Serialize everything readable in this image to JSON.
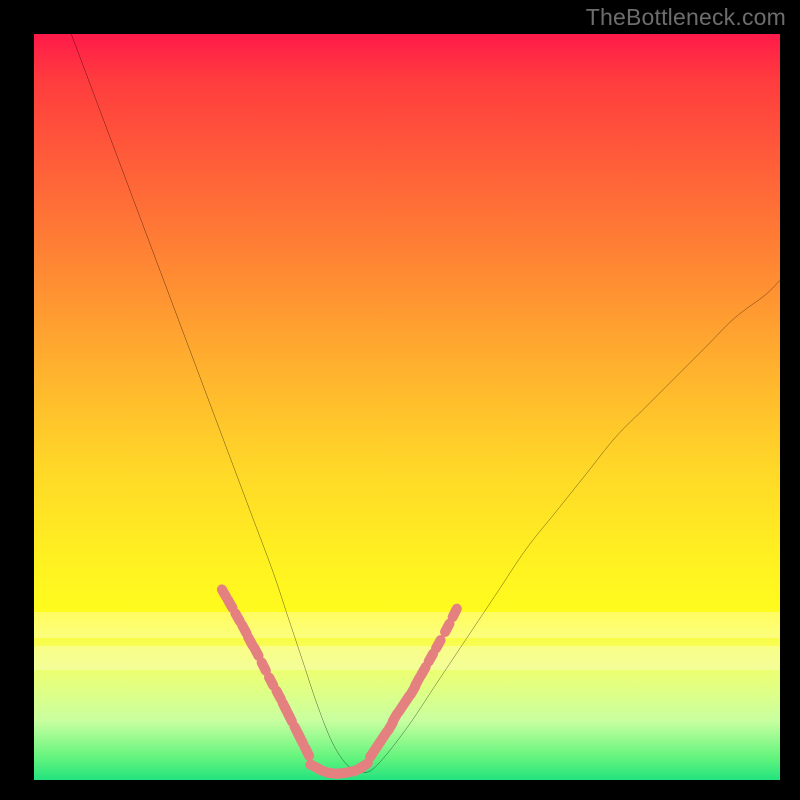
{
  "watermark": {
    "text": "TheBottleneck.com"
  },
  "colors": {
    "background": "#000000",
    "curve": "#000000",
    "marker": "#e58080",
    "gradient_top": "#ff1a4a",
    "gradient_bottom": "#23e37e"
  },
  "chart_data": {
    "type": "line",
    "title": "",
    "xlabel": "",
    "ylabel": "",
    "xlim": [
      0,
      100
    ],
    "ylim": [
      0,
      100
    ],
    "legend": false,
    "grid": false,
    "annotations": [],
    "series": [
      {
        "name": "bottleneck-curve",
        "x": [
          5,
          8,
          11,
          14,
          17,
          20,
          23,
          26,
          29,
          32,
          34,
          36,
          38,
          40,
          42,
          44,
          46,
          50,
          54,
          58,
          62,
          66,
          70,
          74,
          78,
          82,
          86,
          90,
          94,
          98,
          100
        ],
        "y": [
          100,
          92,
          84,
          76,
          68,
          60,
          52,
          44,
          36,
          28,
          22,
          16,
          10,
          5,
          2,
          1,
          2,
          7,
          13,
          19,
          25,
          31,
          36,
          41,
          46,
          50,
          54,
          58,
          62,
          65,
          67
        ]
      }
    ],
    "markers": [
      {
        "name": "left-cluster",
        "x": [
          25.5,
          26.3,
          27.3,
          28.2,
          29.0,
          29.8,
          30.8,
          31.8,
          32.8,
          33.6,
          34.3,
          35.2,
          35.8,
          36.6
        ],
        "y": [
          25.0,
          23.6,
          21.8,
          20.2,
          18.6,
          17.2,
          15.2,
          13.2,
          11.4,
          9.8,
          8.4,
          6.6,
          5.4,
          3.8
        ]
      },
      {
        "name": "bottom-cluster",
        "x": [
          37.6,
          38.8,
          40.0,
          41.2,
          42.4,
          43.4,
          44.2
        ],
        "y": [
          1.8,
          1.2,
          0.9,
          0.9,
          1.1,
          1.4,
          1.9
        ]
      },
      {
        "name": "right-cluster",
        "x": [
          45.4,
          46.2,
          47.0,
          47.8,
          48.4,
          49.2,
          50.0,
          50.8,
          51.4,
          52.2,
          53.2,
          54.2,
          55.4,
          56.4
        ],
        "y": [
          3.6,
          4.8,
          6.0,
          7.2,
          8.4,
          9.6,
          10.8,
          12.0,
          13.2,
          14.6,
          16.4,
          18.2,
          20.4,
          22.4
        ]
      }
    ]
  }
}
